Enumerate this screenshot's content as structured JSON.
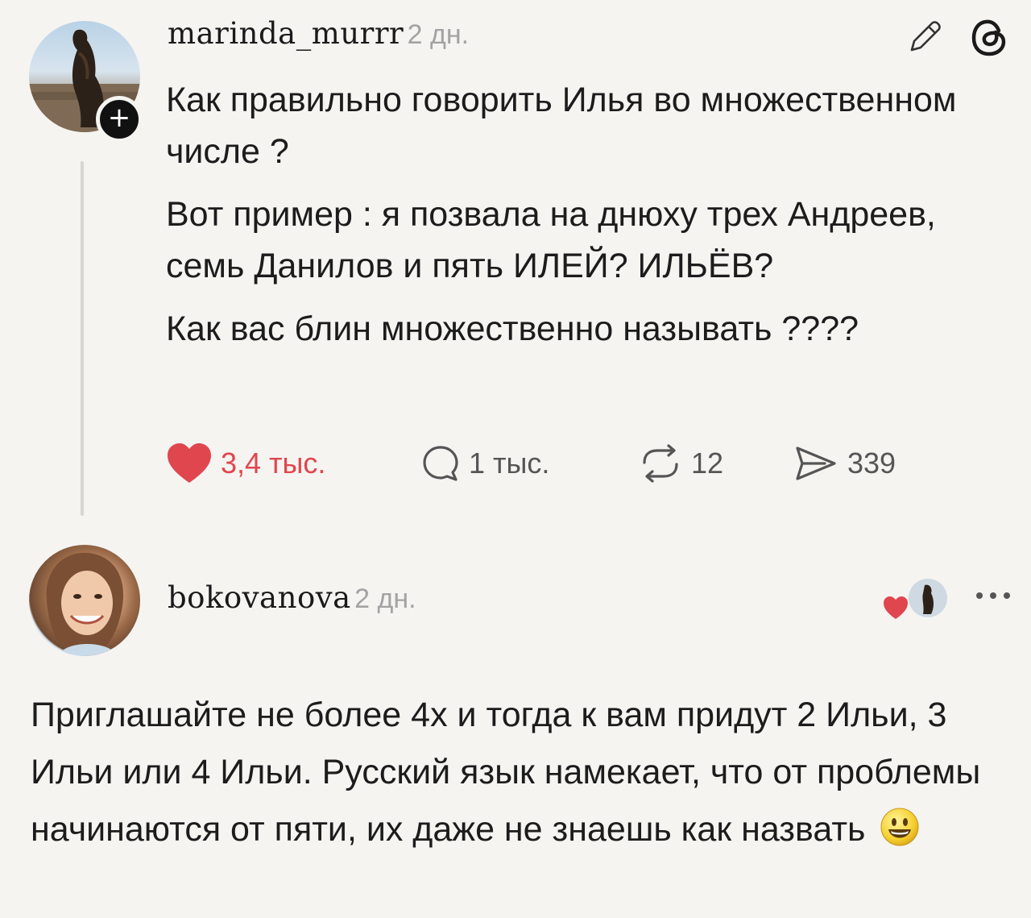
{
  "post": {
    "username": "marinda_murrr",
    "time": "2 дн.",
    "paragraphs": [
      "Как правильно говорить Илья во множественном числе ?",
      "Вот пример : я позвала на днюху трех Андреев, семь Данилов и пять ИЛЕЙ? ИЛЬЁВ?",
      "Как вас блин множественно называть ????"
    ],
    "follow_symbol": "+",
    "actions": {
      "likes": "3,4 тыс.",
      "comments": "1 тыс.",
      "reposts": "12",
      "shares": "339"
    },
    "like_color": "#e0464e"
  },
  "reply": {
    "username": "bokovanova",
    "time": "2 дн.",
    "text": "Приглашайте не более 4х и тогда к вам придут 2 Ильи, 3 Ильи или 4 Ильи. Русский язык намекает, что от проблемы начинаются от пяти, их даже не знаешь как назвать",
    "emoji": "smiley-emoji"
  },
  "icons": {
    "edit": "pencil-icon",
    "app": "threads-logo-icon",
    "like": "heart-icon",
    "comment": "speech-bubble-icon",
    "repost": "repost-arrows-icon",
    "share": "send-icon",
    "more": "ellipsis-icon"
  }
}
